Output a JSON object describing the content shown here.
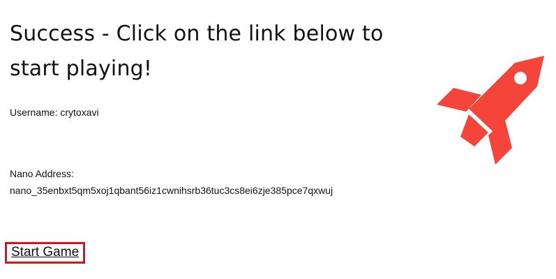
{
  "heading": "Success - Click on the link below to start playing!",
  "username": {
    "label": "Username:",
    "value": "crytoxavi"
  },
  "nano_address": {
    "label": "Nano Address:",
    "value": "nano_35enbxt5qm5xoj1qbant56iz1cwnihsrb36tuc3cs8ei6zje385pce7qxwuj"
  },
  "start_link": {
    "label": "Start Game",
    "highlight_color": "#e0111b"
  },
  "rocket": {
    "icon": "rocket-icon",
    "color": "#f5443a"
  }
}
